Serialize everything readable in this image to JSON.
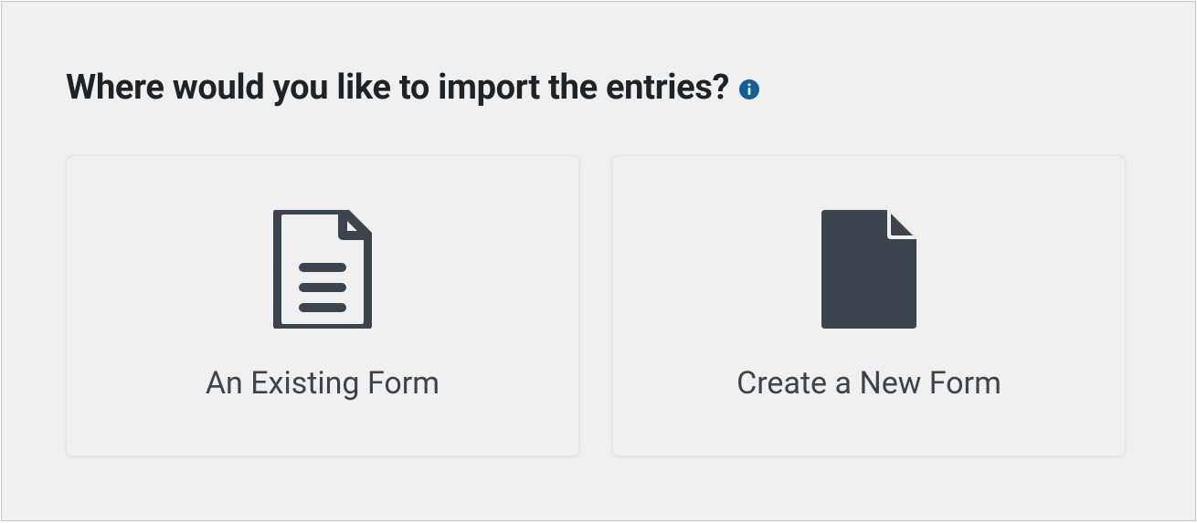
{
  "heading": "Where would you like to import the entries?",
  "info_icon": "info-circle",
  "cards": [
    {
      "id": "existing-form",
      "icon": "document-lines",
      "label": "An Existing Form"
    },
    {
      "id": "new-form",
      "icon": "document-blank",
      "label": "Create a New Form"
    }
  ],
  "colors": {
    "icon_dark": "#3c444d",
    "background": "#f0f0f1",
    "info_blue": "#135e96",
    "text_dark": "#1d2327",
    "text_body": "#3c434a"
  }
}
